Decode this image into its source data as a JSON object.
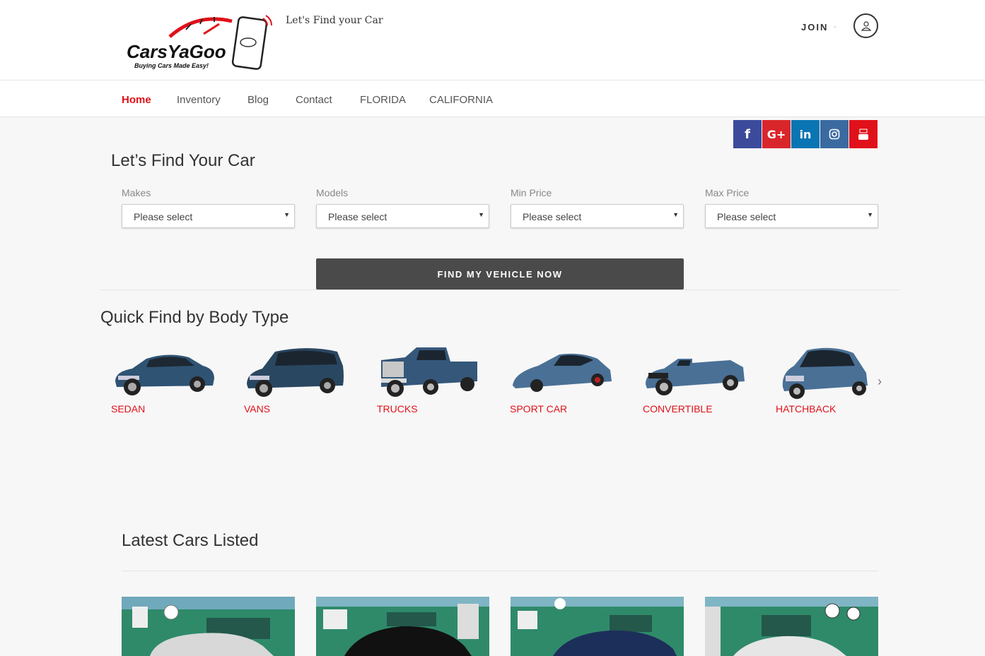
{
  "header": {
    "tagline": "Let's Find your Car",
    "join_label": "JOIN",
    "join_separator": "-",
    "logo": {
      "brand": "CarsYaGoo",
      "slogan": "Buying Cars Made Easy!"
    }
  },
  "nav": {
    "items": [
      {
        "label": "Home",
        "active": true
      },
      {
        "label": "Inventory",
        "active": false
      },
      {
        "label": "Blog",
        "active": false
      },
      {
        "label": "Contact",
        "active": false
      },
      {
        "label": "FLORIDA",
        "active": false
      },
      {
        "label": "CALIFORNIA",
        "active": false
      }
    ]
  },
  "social": [
    {
      "icon": "facebook-icon",
      "color": "#3b4a9a"
    },
    {
      "icon": "google-plus-icon",
      "color": "#d8262b"
    },
    {
      "icon": "linkedin-icon",
      "color": "#0a75b3"
    },
    {
      "icon": "instagram-icon",
      "color": "#3a6aa0"
    },
    {
      "icon": "youtube-icon",
      "color": "#e0111a"
    }
  ],
  "search": {
    "title": "Let’s Find Your Car",
    "fields": [
      {
        "label": "Makes",
        "value": "Please select"
      },
      {
        "label": "Models",
        "value": "Please select"
      },
      {
        "label": "Min Price",
        "value": "Please select"
      },
      {
        "label": "Max Price",
        "value": "Please select"
      }
    ],
    "button_label": "FIND MY VEHICLE NOW"
  },
  "body_types": {
    "title": "Quick Find by Body Type",
    "items": [
      {
        "label": "SEDAN"
      },
      {
        "label": "VANS"
      },
      {
        "label": "TRUCKS"
      },
      {
        "label": "SPORT CAR"
      },
      {
        "label": "CONVERTIBLE"
      },
      {
        "label": "HATCHBACK"
      }
    ]
  },
  "latest": {
    "title": "Latest Cars Listed"
  },
  "colors": {
    "accent": "#e0111a",
    "car_blue": "#2f5373",
    "button_dark": "#4a4a4a"
  }
}
